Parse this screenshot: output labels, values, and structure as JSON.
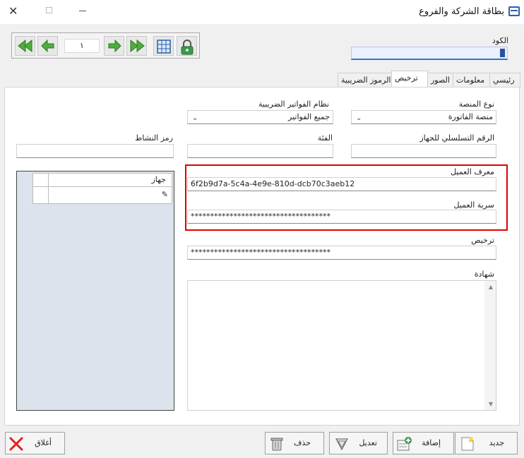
{
  "window": {
    "title": "بطاقة الشركة والفروع",
    "close_glyph": "✕"
  },
  "nav": {
    "record_number": "١"
  },
  "code": {
    "label": "الكود"
  },
  "tabs": [
    {
      "label": "رئيسي"
    },
    {
      "label": "معلومات"
    },
    {
      "label": "الصور"
    },
    {
      "label": "ترخيص"
    },
    {
      "label": "الرموز الضريبية"
    }
  ],
  "form": {
    "platform_type": {
      "label": "نوع المنصة",
      "value": "منصة الفاتورة"
    },
    "tax_invoice_system": {
      "label": "نظام الفواتير الضريبية",
      "value": "جميع الفواتير"
    },
    "device_serial": {
      "label": "الرقم التسلسلي للجهاز",
      "value": ""
    },
    "category": {
      "label": "الفئة",
      "value": ""
    },
    "activity_code": {
      "label": "رمز النشاط",
      "value": ""
    },
    "client_id": {
      "label": "معرف العميل",
      "value": "6f2b9d7a-5c4a-4e9e-810d-dcb70c3aeb12"
    },
    "client_secret": {
      "label": "سرية العميل",
      "value": "************************************"
    },
    "license": {
      "label": "ترخيص",
      "value": "************************************"
    },
    "certificate": {
      "label": "شهادة",
      "value": ""
    }
  },
  "device_grid": {
    "column_header": "جهاز",
    "row_indicator": "✎"
  },
  "buttons": {
    "new": "جديد",
    "add": "إضافة",
    "edit": "تعديل",
    "delete": "حذف",
    "close": "أغلاق"
  },
  "colors": {
    "highlight": "#e00000",
    "nav_green": "#4caf3c",
    "accent_blue": "#3b6fc4"
  }
}
